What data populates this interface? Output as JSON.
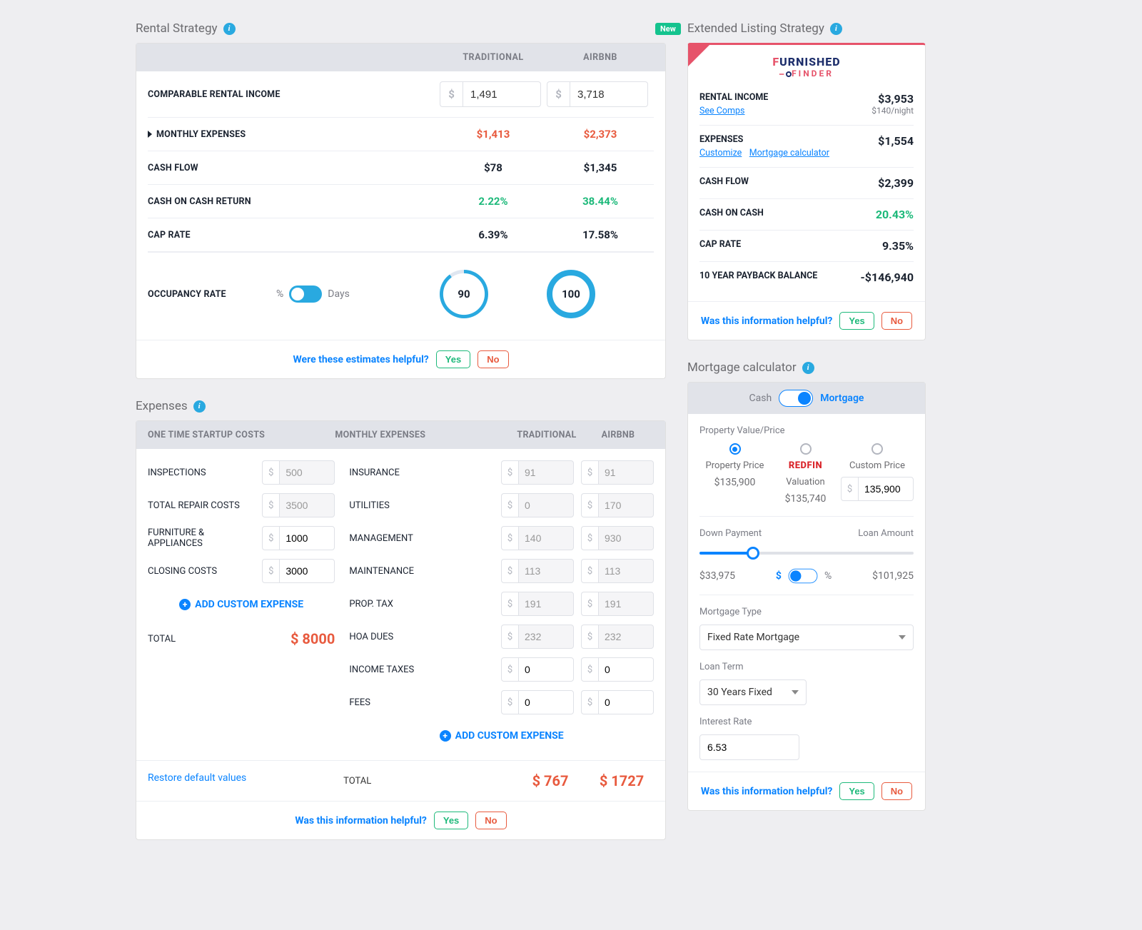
{
  "rental_strategy": {
    "title": "Rental Strategy",
    "headers": {
      "traditional": "TRADITIONAL",
      "airbnb": "AIRBNB"
    },
    "rows": {
      "comparable_income": {
        "label": "COMPARABLE RENTAL INCOME",
        "traditional": "1,491",
        "airbnb": "3,718",
        "prefix": "$"
      },
      "monthly_expenses": {
        "label": "MONTHLY EXPENSES",
        "traditional": "$1,413",
        "airbnb": "$2,373"
      },
      "cash_flow": {
        "label": "CASH FLOW",
        "traditional": "$78",
        "airbnb": "$1,345"
      },
      "coc_return": {
        "label": "CASH ON CASH RETURN",
        "traditional": "2.22%",
        "airbnb": "38.44%"
      },
      "cap_rate": {
        "label": "CAP RATE",
        "traditional": "6.39%",
        "airbnb": "17.58%"
      }
    },
    "occupancy": {
      "label": "OCCUPANCY RATE",
      "unit_left": "%",
      "unit_right": "Days",
      "traditional": "90",
      "airbnb": "100"
    },
    "footer_q": "Were these estimates helpful?",
    "yes": "Yes",
    "no": "No"
  },
  "extended": {
    "badge": "New",
    "title": "Extended Listing Strategy",
    "logo": {
      "f": "F",
      "urnished": "URNISHED",
      "finder": "FINDER"
    },
    "rows": {
      "rental_income": {
        "label": "RENTAL INCOME",
        "sub": "See Comps",
        "value": "$3,953",
        "subval": "$140/night"
      },
      "expenses": {
        "label": "EXPENSES",
        "sub1": "Customize",
        "sub2": "Mortgage calculator",
        "value": "$1,554"
      },
      "cash_flow": {
        "label": "CASH FLOW",
        "value": "$2,399"
      },
      "coc": {
        "label": "CASH ON CASH",
        "value": "20.43%"
      },
      "cap": {
        "label": "CAP RATE",
        "value": "9.35%"
      },
      "payback": {
        "label": "10 YEAR PAYBACK BALANCE",
        "value": "-$146,940"
      }
    },
    "footer_q": "Was this information helpful?",
    "yes": "Yes",
    "no": "No"
  },
  "expenses": {
    "title": "Expenses",
    "headers": {
      "startup": "ONE TIME STARTUP COSTS",
      "monthly": "MONTHLY EXPENSES",
      "traditional": "TRADITIONAL",
      "airbnb": "AIRBNB"
    },
    "startup": [
      {
        "label": "INSPECTIONS",
        "value": "500",
        "disabled": true
      },
      {
        "label": "TOTAL REPAIR COSTS",
        "value": "3500",
        "disabled": true
      },
      {
        "label": "FURNITURE & APPLIANCES",
        "value": "1000"
      },
      {
        "label": "CLOSING COSTS",
        "value": "3000"
      }
    ],
    "monthly": [
      {
        "label": "INSURANCE",
        "trad": "91",
        "bnb": "91"
      },
      {
        "label": "UTILITIES",
        "trad": "0",
        "bnb": "170"
      },
      {
        "label": "MANAGEMENT",
        "trad": "140",
        "bnb": "930"
      },
      {
        "label": "MAINTENANCE",
        "trad": "113",
        "bnb": "113"
      },
      {
        "label": "PROP. TAX",
        "trad": "191",
        "bnb": "191"
      },
      {
        "label": "HOA DUES",
        "trad": "232",
        "bnb": "232"
      },
      {
        "label": "INCOME TAXES",
        "trad": "0",
        "bnb": "0"
      },
      {
        "label": "FEES",
        "trad": "0",
        "bnb": "0"
      }
    ],
    "add": "ADD CUSTOM EXPENSE",
    "total_label": "TOTAL",
    "startup_total": "$ 8000",
    "monthly_total_label": "TOTAL",
    "monthly_total_trad": "$ 767",
    "monthly_total_bnb": "$ 1727",
    "restore": "Restore default values",
    "footer_q": "Was this information helpful?",
    "yes": "Yes",
    "no": "No"
  },
  "mortgage": {
    "title": "Mortgage calculator",
    "toggle": {
      "cash": "Cash",
      "mortgage": "Mortgage"
    },
    "prop_value_label": "Property Value/Price",
    "options": {
      "property_price": {
        "label": "Property Price",
        "value": "$135,900"
      },
      "redfin": {
        "brand": "REDFIN",
        "label": "Valuation",
        "value": "$135,740"
      },
      "custom": {
        "label": "Custom Price",
        "value": "135,900"
      }
    },
    "down_payment_label": "Down Payment",
    "loan_amount_label": "Loan Amount",
    "down_payment_value": "$33,975",
    "loan_amount_value": "$101,925",
    "unit_dollar": "$",
    "unit_percent": "%",
    "mortgage_type_label": "Mortgage Type",
    "mortgage_type_value": "Fixed Rate Mortgage",
    "loan_term_label": "Loan Term",
    "loan_term_value": "30 Years Fixed",
    "interest_label": "Interest Rate",
    "interest_value": "6.53",
    "footer_q": "Was this information helpful?",
    "yes": "Yes",
    "no": "No"
  }
}
